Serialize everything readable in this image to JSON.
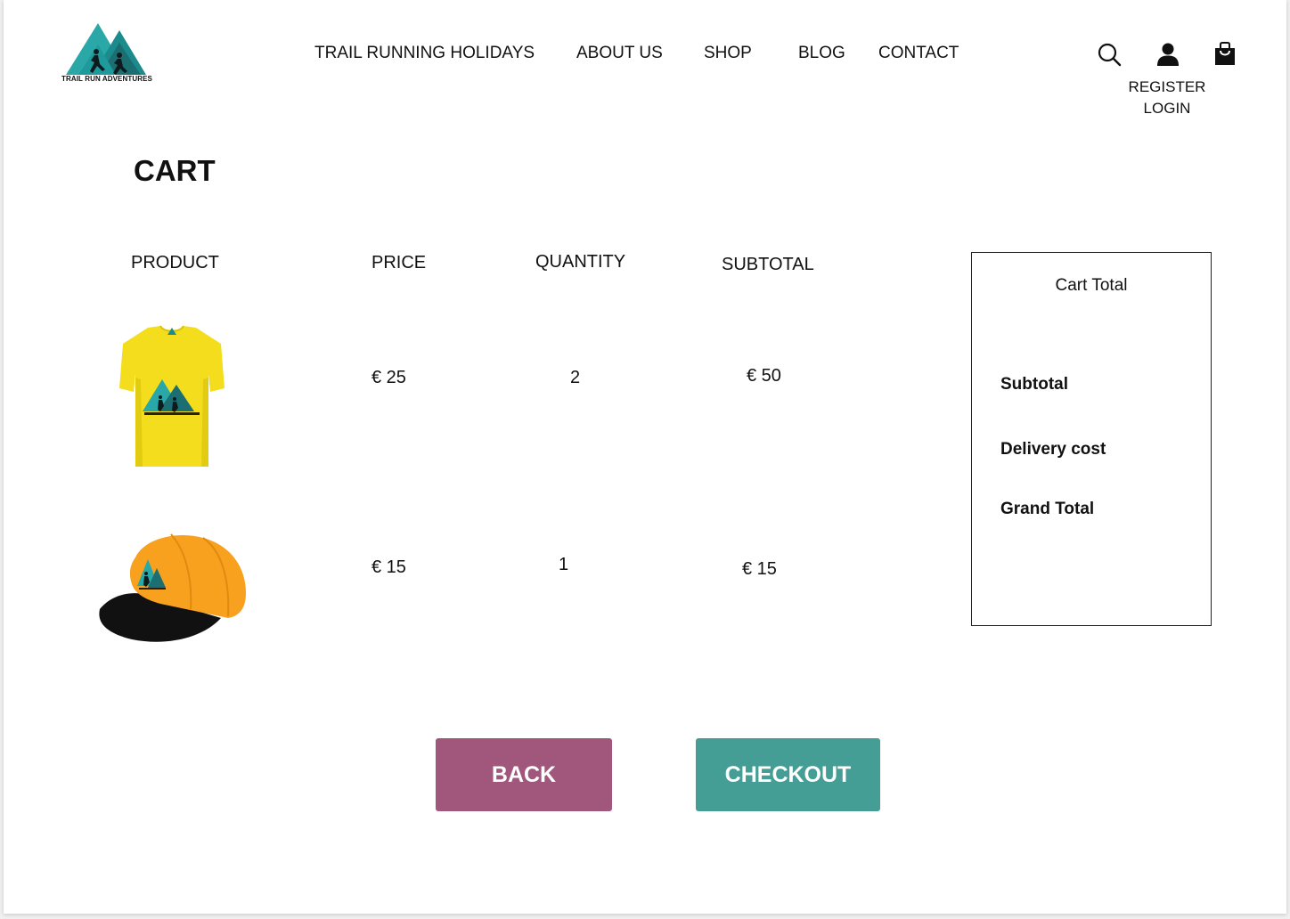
{
  "brand": {
    "logo_text": "TRAIL RUN ADVENTURES"
  },
  "nav": [
    {
      "label": "TRAIL RUNNING HOLIDAYS"
    },
    {
      "label": "ABOUT US"
    },
    {
      "label": "SHOP"
    },
    {
      "label": "BLOG"
    },
    {
      "label": "CONTACT"
    }
  ],
  "header_icons": [
    "search-icon",
    "user-icon",
    "shopping-bag-icon"
  ],
  "account": {
    "register": "REGISTER",
    "login": "LOGIN"
  },
  "page_title": "CART",
  "cart": {
    "columns": [
      "PRODUCT",
      "PRICE",
      "QUANTITY",
      "SUBTOTAL"
    ],
    "items": [
      {
        "product": "yellow t-shirt",
        "price": "€ 25",
        "quantity": "2",
        "subtotal": "€ 50"
      },
      {
        "product": "orange cap",
        "price": "€ 15",
        "quantity": "1",
        "subtotal": "€ 15"
      }
    ]
  },
  "summary": {
    "title": "Cart Total",
    "subtotal_label": "Subtotal",
    "delivery_label": "Delivery cost",
    "grand_total_label": "Grand Total"
  },
  "buttons": {
    "back": "BACK",
    "checkout": "CHECKOUT"
  },
  "colors": {
    "back_button": "#a0577b",
    "checkout_button": "#459e96",
    "logo_teal": "#2aa8a8",
    "logo_dark_teal": "#1b6f72",
    "shirt_yellow": "#f3dd1c",
    "cap_orange": "#f7a11f"
  }
}
